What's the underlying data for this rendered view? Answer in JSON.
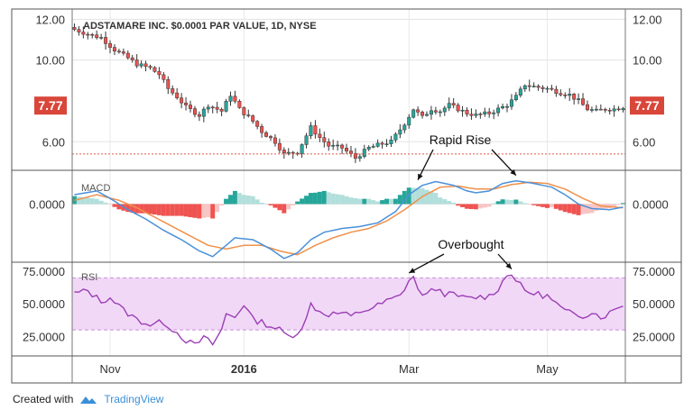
{
  "chart_data": [
    {
      "type": "candlestick",
      "title": "ADSTAMARE INC. $0.0001 PAR VALUE, 1D, NYSE",
      "price_ticks": [
        "12.00",
        "10.00",
        "6.00"
      ],
      "last_price": "7.77",
      "ylim": [
        4.6,
        12.5
      ],
      "support_level": 5.4,
      "colors": {
        "up": "#26a69a",
        "down": "#ef5350",
        "wick": "#333333",
        "support": "#e05a4a",
        "price_box": "#d9463a"
      },
      "close_anchors": [
        [
          0,
          11.5
        ],
        [
          4,
          11.2
        ],
        [
          6,
          11.1
        ],
        [
          9,
          10.5
        ],
        [
          12,
          10.1
        ],
        [
          14,
          9.8
        ],
        [
          17,
          9.6
        ],
        [
          19,
          9.3
        ],
        [
          21,
          8.6
        ],
        [
          23,
          8.2
        ],
        [
          25,
          7.7
        ],
        [
          28,
          7.3
        ],
        [
          30,
          7.8
        ],
        [
          33,
          7.5
        ],
        [
          35,
          8.3
        ],
        [
          37,
          7.6
        ],
        [
          40,
          7.0
        ],
        [
          42,
          6.5
        ],
        [
          45,
          6.0
        ],
        [
          47,
          5.4
        ],
        [
          50,
          5.5
        ],
        [
          52,
          6.3
        ],
        [
          53,
          6.7
        ],
        [
          55,
          6.2
        ],
        [
          57,
          5.8
        ],
        [
          60,
          5.7
        ],
        [
          63,
          5.2
        ],
        [
          66,
          5.7
        ],
        [
          69,
          5.9
        ],
        [
          71,
          6.0
        ],
        [
          74,
          6.9
        ],
        [
          76,
          7.6
        ],
        [
          78,
          7.2
        ],
        [
          80,
          7.6
        ],
        [
          82,
          7.5
        ],
        [
          84,
          7.8
        ],
        [
          86,
          7.6
        ],
        [
          88,
          7.4
        ],
        [
          90,
          7.3
        ],
        [
          93,
          7.4
        ],
        [
          95,
          7.6
        ],
        [
          97,
          7.8
        ],
        [
          99,
          8.2
        ],
        [
          101,
          8.8
        ],
        [
          103,
          8.7
        ],
        [
          106,
          8.6
        ],
        [
          109,
          8.4
        ],
        [
          111,
          8.3
        ],
        [
          113,
          8.0
        ],
        [
          115,
          7.6
        ],
        [
          117,
          7.5
        ],
        [
          119,
          7.6
        ],
        [
          121,
          7.6
        ],
        [
          123,
          7.7
        ]
      ]
    },
    {
      "type": "line",
      "title": "MACD",
      "y_tick": "0.0000",
      "ylim": [
        -1.55,
        0.9
      ],
      "colors": {
        "macd": "#4a90d9",
        "signal": "#f0904a",
        "hist_up": "#26a69a",
        "hist_up_light": "#b2dfdb",
        "hist_down": "#ef5350",
        "hist_down_light": "#f8c4c4"
      },
      "macd_anchors": [
        [
          0,
          0.25
        ],
        [
          5,
          0.35
        ],
        [
          8,
          0.15
        ],
        [
          12,
          -0.15
        ],
        [
          16,
          -0.4
        ],
        [
          20,
          -0.7
        ],
        [
          24,
          -0.95
        ],
        [
          28,
          -1.25
        ],
        [
          31,
          -1.4
        ],
        [
          33,
          -1.2
        ],
        [
          36,
          -0.9
        ],
        [
          40,
          -0.95
        ],
        [
          44,
          -1.2
        ],
        [
          47,
          -1.45
        ],
        [
          50,
          -1.3
        ],
        [
          53,
          -0.95
        ],
        [
          56,
          -0.75
        ],
        [
          60,
          -0.65
        ],
        [
          64,
          -0.6
        ],
        [
          68,
          -0.5
        ],
        [
          72,
          -0.2
        ],
        [
          75,
          0.25
        ],
        [
          78,
          0.5
        ],
        [
          81,
          0.6
        ],
        [
          85,
          0.5
        ],
        [
          88,
          0.35
        ],
        [
          90,
          0.3
        ],
        [
          93,
          0.35
        ],
        [
          96,
          0.55
        ],
        [
          99,
          0.62
        ],
        [
          103,
          0.55
        ],
        [
          107,
          0.45
        ],
        [
          110,
          0.25
        ],
        [
          113,
          0.0
        ],
        [
          116,
          -0.12
        ],
        [
          120,
          -0.15
        ],
        [
          123,
          -0.08
        ]
      ],
      "signal_anchors": [
        [
          0,
          0.1
        ],
        [
          5,
          0.25
        ],
        [
          10,
          0.1
        ],
        [
          14,
          -0.1
        ],
        [
          18,
          -0.35
        ],
        [
          22,
          -0.6
        ],
        [
          26,
          -0.85
        ],
        [
          30,
          -1.1
        ],
        [
          34,
          -1.2
        ],
        [
          38,
          -1.1
        ],
        [
          42,
          -1.1
        ],
        [
          46,
          -1.25
        ],
        [
          50,
          -1.35
        ],
        [
          54,
          -1.1
        ],
        [
          58,
          -0.9
        ],
        [
          62,
          -0.75
        ],
        [
          66,
          -0.65
        ],
        [
          70,
          -0.45
        ],
        [
          74,
          -0.15
        ],
        [
          78,
          0.2
        ],
        [
          82,
          0.45
        ],
        [
          86,
          0.48
        ],
        [
          90,
          0.4
        ],
        [
          94,
          0.4
        ],
        [
          98,
          0.52
        ],
        [
          102,
          0.58
        ],
        [
          106,
          0.55
        ],
        [
          110,
          0.4
        ],
        [
          114,
          0.15
        ],
        [
          118,
          -0.05
        ],
        [
          123,
          -0.1
        ]
      ],
      "annotations": [
        {
          "label": "Rapid Rise",
          "arrows": [
            [
              77,
              0.5
            ],
            [
              99,
              0.62
            ]
          ]
        }
      ]
    },
    {
      "type": "line",
      "title": "RSI",
      "y_ticks": [
        "75.0000",
        "50.0000",
        "25.0000"
      ],
      "ylim": [
        10,
        82
      ],
      "bands": [
        30,
        70
      ],
      "colors": {
        "line": "#9b3fb5",
        "band_fill": "#f1d8f7",
        "band_line": "#c890d8"
      },
      "rsi_anchors": [
        [
          0,
          58
        ],
        [
          3,
          60
        ],
        [
          6,
          52
        ],
        [
          8,
          55
        ],
        [
          11,
          45
        ],
        [
          14,
          38
        ],
        [
          17,
          34
        ],
        [
          20,
          36
        ],
        [
          23,
          28
        ],
        [
          25,
          22
        ],
        [
          27,
          18
        ],
        [
          29,
          24
        ],
        [
          31,
          19
        ],
        [
          33,
          30
        ],
        [
          34,
          42
        ],
        [
          36,
          40
        ],
        [
          38,
          50
        ],
        [
          40,
          38
        ],
        [
          42,
          36
        ],
        [
          44,
          33
        ],
        [
          46,
          30
        ],
        [
          48,
          25
        ],
        [
          50,
          28
        ],
        [
          52,
          38
        ],
        [
          53,
          50
        ],
        [
          55,
          44
        ],
        [
          57,
          42
        ],
        [
          60,
          43
        ],
        [
          62,
          40
        ],
        [
          64,
          44
        ],
        [
          67,
          47
        ],
        [
          70,
          52
        ],
        [
          73,
          56
        ],
        [
          75,
          68
        ],
        [
          76,
          71
        ],
        [
          77,
          60
        ],
        [
          79,
          57
        ],
        [
          81,
          62
        ],
        [
          83,
          58
        ],
        [
          86,
          56
        ],
        [
          88,
          54
        ],
        [
          90,
          55
        ],
        [
          93,
          56
        ],
        [
          95,
          62
        ],
        [
          97,
          72
        ],
        [
          98,
          74
        ],
        [
          99,
          68
        ],
        [
          101,
          60
        ],
        [
          103,
          58
        ],
        [
          106,
          56
        ],
        [
          108,
          50
        ],
        [
          110,
          44
        ],
        [
          112,
          42
        ],
        [
          114,
          41
        ],
        [
          116,
          44
        ],
        [
          118,
          40
        ],
        [
          120,
          43
        ],
        [
          122,
          48
        ],
        [
          123,
          50
        ]
      ],
      "annotations": [
        {
          "label": "Overbought",
          "arrows": [
            [
              75,
              71
            ],
            [
              98,
              74
            ]
          ]
        }
      ]
    }
  ],
  "time_axis": {
    "labels": [
      {
        "text": "Nov",
        "bar": 8,
        "bold": false
      },
      {
        "text": "2016",
        "bar": 38,
        "bold": true
      },
      {
        "text": "Mar",
        "bar": 75,
        "bold": false
      },
      {
        "text": "May",
        "bar": 106,
        "bold": false
      }
    ],
    "bar_count": 124
  },
  "footer": {
    "prefix": "Created with",
    "brand": "TradingView",
    "logo": "tradingview-cloud-icon"
  }
}
